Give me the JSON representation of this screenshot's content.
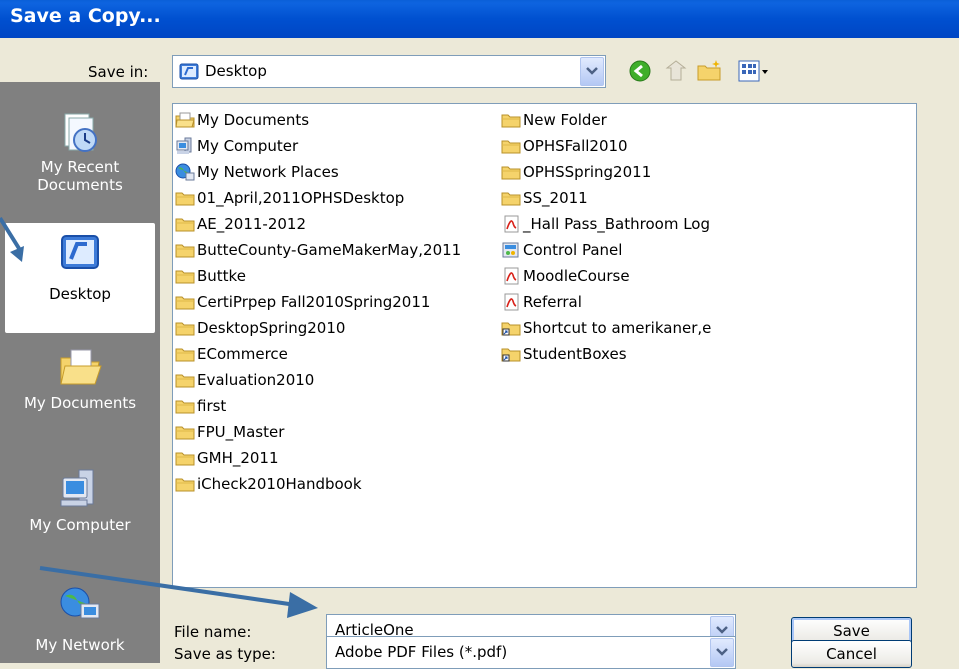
{
  "window": {
    "title": "Save a Copy..."
  },
  "save_in": {
    "label": "Save in:",
    "value": "Desktop"
  },
  "toolbar": {
    "icons": [
      "back-icon",
      "up-folder-icon",
      "new-folder-icon",
      "views-menu-icon"
    ]
  },
  "places": [
    {
      "label1": "My Recent",
      "label2": "Documents",
      "icon": "recent-documents-icon"
    },
    {
      "label1": "Desktop",
      "label2": "",
      "icon": "desktop-icon"
    },
    {
      "label1": "My Documents",
      "label2": "",
      "icon": "my-documents-icon"
    },
    {
      "label1": "My Computer",
      "label2": "",
      "icon": "my-computer-icon"
    },
    {
      "label1": "My Network",
      "label2": "",
      "icon": "my-network-icon"
    }
  ],
  "files": {
    "col1": [
      {
        "name": "My Documents",
        "icon": "mydocs"
      },
      {
        "name": "My Computer",
        "icon": "computer"
      },
      {
        "name": "My Network Places",
        "icon": "network"
      },
      {
        "name": "01_April,2011OPHSDesktop",
        "icon": "folder"
      },
      {
        "name": "AE_2011-2012",
        "icon": "folder"
      },
      {
        "name": "ButteCounty-GameMakerMay,2011",
        "icon": "folder"
      },
      {
        "name": "Buttke",
        "icon": "folder"
      },
      {
        "name": "CertiPrpep Fall2010Spring2011",
        "icon": "folder"
      },
      {
        "name": "DesktopSpring2010",
        "icon": "folder"
      },
      {
        "name": "ECommerce",
        "icon": "folder"
      },
      {
        "name": "Evaluation2010",
        "icon": "folder"
      },
      {
        "name": "first",
        "icon": "folder"
      },
      {
        "name": "FPU_Master",
        "icon": "folder"
      },
      {
        "name": "GMH_2011",
        "icon": "folder"
      },
      {
        "name": "iCheck2010Handbook",
        "icon": "folder"
      }
    ],
    "col2": [
      {
        "name": "New Folder",
        "icon": "folder"
      },
      {
        "name": "OPHSFall2010",
        "icon": "folder"
      },
      {
        "name": "OPHSSpring2011",
        "icon": "folder"
      },
      {
        "name": "SS_2011",
        "icon": "folder"
      },
      {
        "name": "_Hall Pass_Bathroom Log",
        "icon": "pdf"
      },
      {
        "name": "Control Panel",
        "icon": "controlpanel"
      },
      {
        "name": "MoodleCourse",
        "icon": "pdf"
      },
      {
        "name": "Referral",
        "icon": "pdf"
      },
      {
        "name": "Shortcut to amerikaner,e",
        "icon": "shortcut-folder"
      },
      {
        "name": "StudentBoxes",
        "icon": "shortcut-folder"
      }
    ]
  },
  "file_name": {
    "label": "File name:",
    "value": "ArticleOne"
  },
  "save_as_type": {
    "label": "Save as type:",
    "value": "Adobe PDF Files (*.pdf)"
  },
  "buttons": {
    "save": "Save",
    "cancel": "Cancel"
  },
  "colors": {
    "titlebar": "#0050D0",
    "dialog": "#ECE9D8",
    "places_bar": "#808080",
    "annotation_arrow": "#3A6EA5"
  }
}
